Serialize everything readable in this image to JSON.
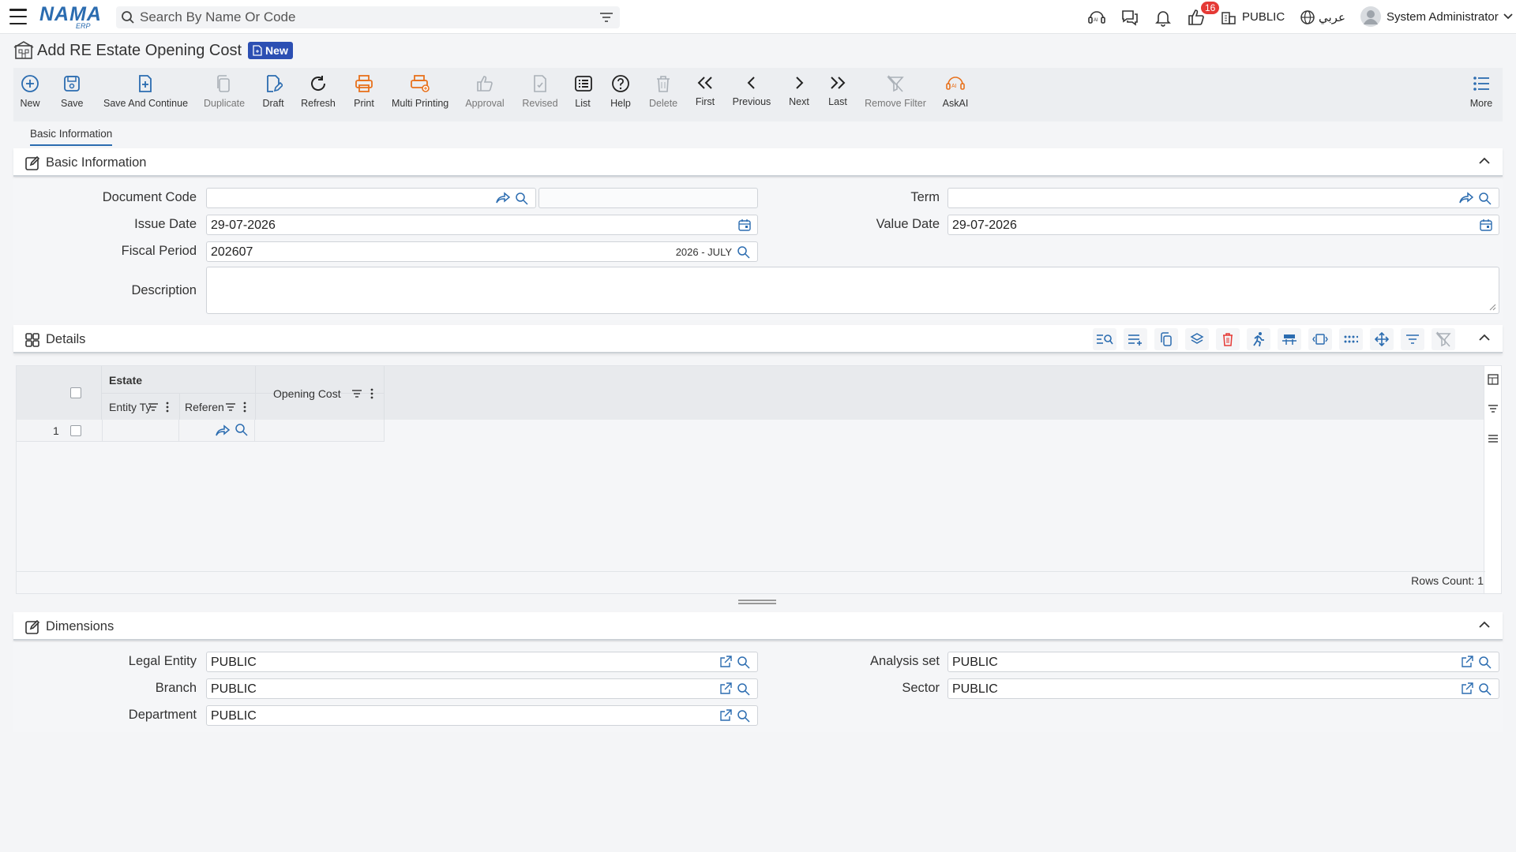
{
  "app": {
    "logo_text": "NAMA",
    "logo_sub": "ERP"
  },
  "search": {
    "placeholder": "Search By Name Or Code"
  },
  "header": {
    "notifications_count": "16",
    "company": "PUBLIC",
    "language": "عربي",
    "user_name": "System Administrator"
  },
  "page": {
    "title": "Add RE Estate Opening Cost",
    "status_badge": "New"
  },
  "toolbar": {
    "new": "New",
    "save": "Save",
    "save_continue": "Save And Continue",
    "duplicate": "Duplicate",
    "draft": "Draft",
    "refresh": "Refresh",
    "print": "Print",
    "multi_printing": "Multi Printing",
    "approval": "Approval",
    "revised": "Revised",
    "list": "List",
    "help": "Help",
    "delete": "Delete",
    "first": "First",
    "previous": "Previous",
    "next": "Next",
    "last": "Last",
    "remove_filter": "Remove Filter",
    "askai": "AskAI",
    "more": "More"
  },
  "tabs": [
    {
      "label": "Basic Information"
    }
  ],
  "basic": {
    "section_title": "Basic Information",
    "document_code_label": "Document Code",
    "document_code": "",
    "document_code_name": "",
    "term_label": "Term",
    "term": "",
    "issue_date_label": "Issue Date",
    "issue_date": "29-07-2026",
    "value_date_label": "Value Date",
    "value_date": "29-07-2026",
    "fiscal_period_label": "Fiscal Period",
    "fiscal_period": "202607",
    "fiscal_period_name": "2026 - JULY",
    "description_label": "Description",
    "description": ""
  },
  "details": {
    "section_title": "Details",
    "group_header": "Estate",
    "columns": {
      "entity_type": "Entity Ty",
      "reference": "Referen",
      "opening_cost": "Opening Cost"
    },
    "rows": [
      {
        "num": "1",
        "entity_type": "",
        "reference": "",
        "opening_cost": ""
      }
    ],
    "rows_count": "Rows Count: 1"
  },
  "dimensions": {
    "section_title": "Dimensions",
    "legal_entity_label": "Legal Entity",
    "legal_entity": "PUBLIC",
    "analysis_set_label": "Analysis set",
    "analysis_set": "PUBLIC",
    "branch_label": "Branch",
    "branch": "PUBLIC",
    "sector_label": "Sector",
    "sector": "PUBLIC",
    "department_label": "Department",
    "department": "PUBLIC"
  },
  "colors": {
    "accent": "#2b6cb0",
    "badge_bg": "#2c4fb3",
    "print_orange": "#e8711c",
    "danger": "#e53935"
  }
}
